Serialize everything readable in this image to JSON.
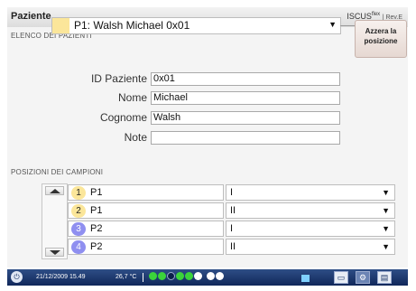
{
  "window": {
    "title": "Paziente",
    "brand": "ISCUS",
    "brand_sup": "flex",
    "rev": "| Rev.E"
  },
  "patients_section": {
    "label": "ELENCO DEI PAZIENTI",
    "selected": "P1: Walsh Michael 0x01"
  },
  "reset_button": {
    "line1": "Azzera la",
    "line2": "posizione"
  },
  "form": {
    "id_label": "ID Paziente",
    "id_value": "0x01",
    "name_label": "Nome",
    "name_value": "Michael",
    "surname_label": "Cognome",
    "surname_value": "Walsh",
    "notes_label": "Note",
    "notes_value": ""
  },
  "samples_section": {
    "label": "POSIZIONI DEI CAMPIONI",
    "rows": [
      {
        "num": "1",
        "patient": "P1",
        "value": "I",
        "color": "#fbe69a"
      },
      {
        "num": "2",
        "patient": "P1",
        "value": "II",
        "color": "#fbe69a"
      },
      {
        "num": "3",
        "patient": "P2",
        "value": "I",
        "color": "#8f8ff0"
      },
      {
        "num": "4",
        "patient": "P2",
        "value": "II",
        "color": "#8f8ff0"
      }
    ]
  },
  "status": {
    "datetime": "21/12/2009 15.49",
    "temperature": "26,7 °C",
    "power_icon": "power-icon",
    "colors": {
      "green": "#3bd33b",
      "dark": "#0b1f4a",
      "white": "#ffffff",
      "blue": "#5aa2ff"
    }
  },
  "colors": {
    "accent": "#2e4e86",
    "yellow": "#fbe69a",
    "purple": "#8f8ff0"
  }
}
